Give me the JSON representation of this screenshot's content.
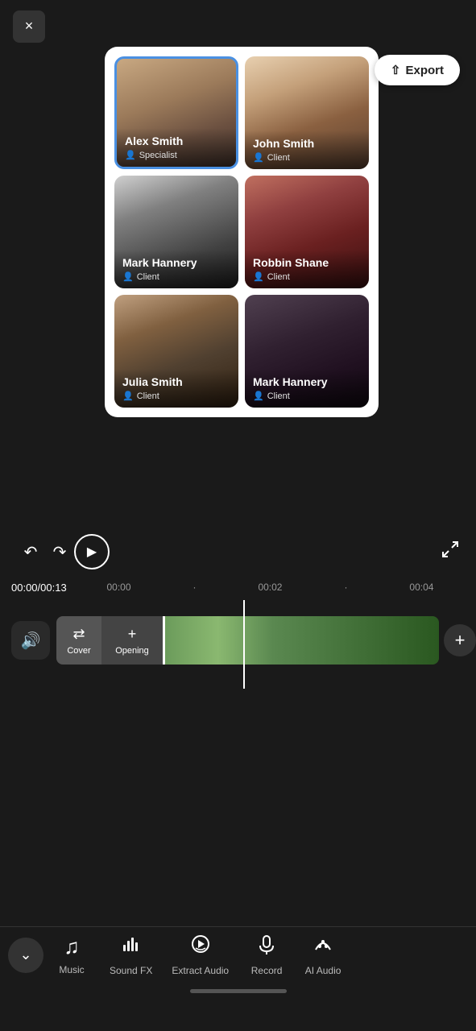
{
  "app": {
    "close_label": "×",
    "export_label": "↑ Export"
  },
  "popup": {
    "persons": [
      {
        "id": "alex-smith",
        "name": "Alex Smith",
        "role": "Specialist",
        "photo_class": "photo-alex",
        "selected": true
      },
      {
        "id": "john-smith",
        "name": "John Smith",
        "role": "Client",
        "photo_class": "photo-john",
        "selected": false
      },
      {
        "id": "mark-hannery",
        "name": "Mark Hannery",
        "role": "Client",
        "photo_class": "photo-mark-h",
        "selected": false
      },
      {
        "id": "robbin-shane",
        "name": "Robbin Shane",
        "role": "Client",
        "photo_class": "photo-robbin",
        "selected": false
      },
      {
        "id": "julia-smith",
        "name": "Julia Smith",
        "role": "Client",
        "photo_class": "photo-julia",
        "selected": false
      },
      {
        "id": "mark-hannery-2",
        "name": "Mark Hannery",
        "role": "Client",
        "photo_class": "photo-mark2",
        "selected": false
      }
    ]
  },
  "timeline": {
    "current_time": "00:00",
    "total_time": "00:13",
    "marks": [
      "00:00",
      "00:02",
      "00:04"
    ],
    "tracks": {
      "cover_label": "Cover",
      "opening_label": "Opening",
      "add_label": "+"
    }
  },
  "toolbar": {
    "collapse_icon": "chevron-down",
    "tabs": [
      {
        "id": "music",
        "label": "Music",
        "icon": "♫"
      },
      {
        "id": "sound-fx",
        "label": "Sound FX",
        "icon": "📊"
      },
      {
        "id": "extract-audio",
        "label": "Extract Audio",
        "icon": "🎵"
      },
      {
        "id": "record",
        "label": "Record",
        "icon": "🎤"
      },
      {
        "id": "ai-audio",
        "label": "AI Audio",
        "icon": "🎼"
      }
    ]
  }
}
